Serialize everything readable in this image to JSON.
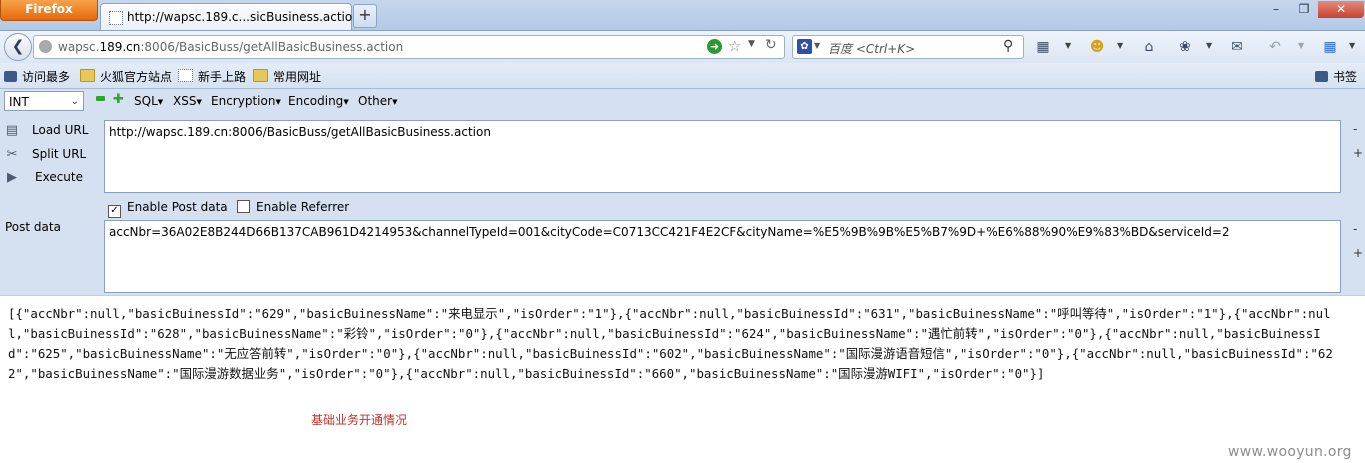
{
  "browser": {
    "menu_button": "Firefox",
    "tab_title": "http://wapsc.189.c...sicBusiness.action",
    "new_tab": "+",
    "window_controls": {
      "minimize": "–",
      "maximize": "❐",
      "close": "✕"
    }
  },
  "navbar": {
    "url_prefix": "wapsc.",
    "url_host": "189.cn",
    "url_rest": ":8006/BasicBuss/getAllBasicBusiness.action",
    "search_placeholder": "百度 <Ctrl+K>"
  },
  "bookmarks": {
    "items": [
      "访问最多",
      "火狐官方站点",
      "新手上路",
      "常用网址"
    ],
    "right_label": "书签"
  },
  "hackbar": {
    "select_value": "INT",
    "menus": [
      "SQL",
      "XSS",
      "Encryption",
      "Encoding",
      "Other"
    ],
    "actions": [
      "Load URL",
      "Split URL",
      "Execute"
    ],
    "url_value": "http://wapsc.189.cn:8006/BasicBuss/getAllBasicBusiness.action",
    "enable_post_label": "Enable Post data",
    "enable_post_checked": true,
    "enable_referrer_label": "Enable Referrer",
    "enable_referrer_checked": false,
    "post_label": "Post data",
    "post_value": "accNbr=36A02E8B244D66B137CAB961D4214953&channelTypeId=001&cityCode=C0713CC421F4E2CF&cityName=%E5%9B%9B%E5%B7%9D+%E6%88%90%E9%83%BD&serviceId=2",
    "side_minus": "-",
    "side_plus": "+"
  },
  "content": {
    "json_text": "[{\"accNbr\":null,\"basicBuinessId\":\"629\",\"basicBuinessName\":\"来电显示\",\"isOrder\":\"1\"},{\"accNbr\":null,\"basicBuinessId\":\"631\",\"basicBuinessName\":\"呼叫等待\",\"isOrder\":\"1\"},{\"accNbr\":null,\"basicBuinessId\":\"628\",\"basicBuinessName\":\"彩铃\",\"isOrder\":\"0\"},{\"accNbr\":null,\"basicBuinessId\":\"624\",\"basicBuinessName\":\"遇忙前转\",\"isOrder\":\"0\"},{\"accNbr\":null,\"basicBuinessId\":\"625\",\"basicBuinessName\":\"无应答前转\",\"isOrder\":\"0\"},{\"accNbr\":null,\"basicBuinessId\":\"602\",\"basicBuinessName\":\"国际漫游语音短信\",\"isOrder\":\"0\"},{\"accNbr\":null,\"basicBuinessId\":\"622\",\"basicBuinessName\":\"国际漫游数据业务\",\"isOrder\":\"0\"},{\"accNbr\":null,\"basicBuinessId\":\"660\",\"basicBuinessName\":\"国际漫游WIFI\",\"isOrder\":\"0\"}]",
    "note": "基础业务开通情况",
    "watermark": "www.wooyun.org"
  }
}
